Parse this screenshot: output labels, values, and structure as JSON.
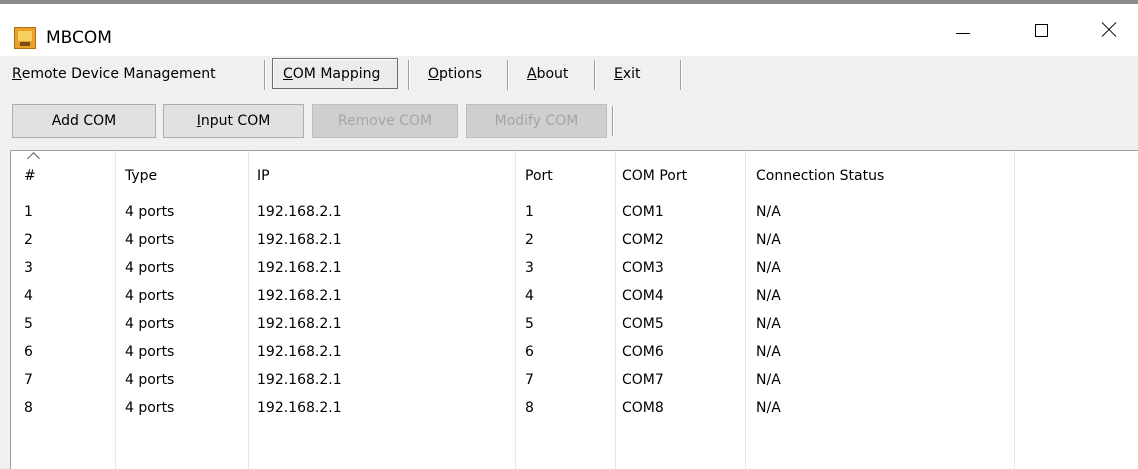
{
  "window": {
    "title": "MBCOM",
    "app_icon": "mbcom-app-icon",
    "controls": [
      "minimize-icon",
      "maximize-icon",
      "close-icon"
    ]
  },
  "menu": [
    {
      "label": "Remote Device Management",
      "mnemonic": "R"
    },
    {
      "label": "COM Mapping",
      "mnemonic": "C",
      "active": true
    },
    {
      "label": "Options",
      "mnemonic": "O"
    },
    {
      "label": "About",
      "mnemonic": "A"
    },
    {
      "label": "Exit",
      "mnemonic": "E"
    }
  ],
  "toolbar": [
    {
      "label": "Add COM",
      "enabled": true
    },
    {
      "label": "Input COM",
      "mnemonic": "I",
      "enabled": true
    },
    {
      "label": "Remove COM",
      "enabled": false
    },
    {
      "label": "Modify COM",
      "enabled": false
    }
  ],
  "table": {
    "sort_column": "#",
    "sort_direction": "ascending",
    "columns": [
      "#",
      "Type",
      "IP",
      "Port",
      "COM Port",
      "Connection Status"
    ],
    "rows": [
      [
        "1",
        "4 ports",
        "192.168.2.1",
        "1",
        "COM1",
        "N/A"
      ],
      [
        "2",
        "4 ports",
        "192.168.2.1",
        "2",
        "COM2",
        "N/A"
      ],
      [
        "3",
        "4 ports",
        "192.168.2.1",
        "3",
        "COM3",
        "N/A"
      ],
      [
        "4",
        "4 ports",
        "192.168.2.1",
        "4",
        "COM4",
        "N/A"
      ],
      [
        "5",
        "4 ports",
        "192.168.2.1",
        "5",
        "COM5",
        "N/A"
      ],
      [
        "6",
        "4 ports",
        "192.168.2.1",
        "6",
        "COM6",
        "N/A"
      ],
      [
        "7",
        "4 ports",
        "192.168.2.1",
        "7",
        "COM7",
        "N/A"
      ],
      [
        "8",
        "4 ports",
        "192.168.2.1",
        "8",
        "COM8",
        "N/A"
      ]
    ]
  }
}
